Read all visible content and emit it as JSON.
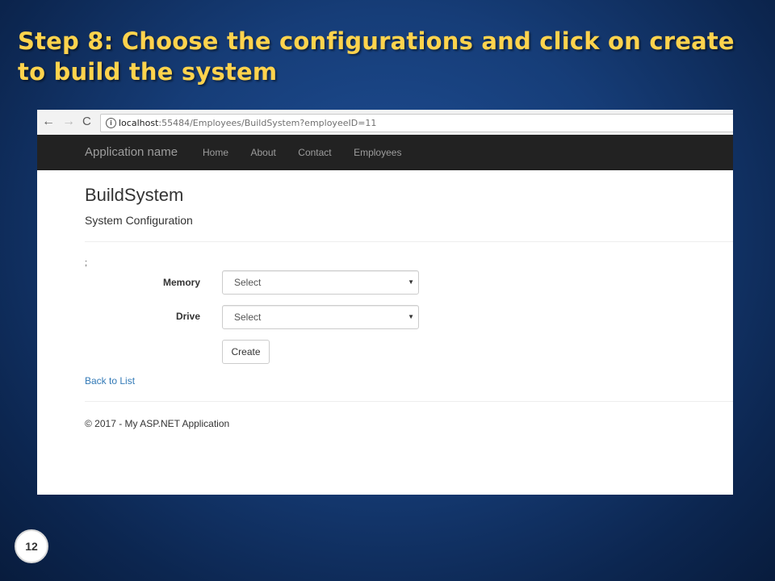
{
  "slide": {
    "title": "Step 8:  Choose the configurations and click on create to build the system",
    "number": "12"
  },
  "browser": {
    "back_icon": "←",
    "forward_icon": "→",
    "reload_icon": "C",
    "info_icon": "i",
    "url_host": "localhost",
    "url_rest": ":55484/Employees/BuildSystem?employeeID=11"
  },
  "navbar": {
    "brand": "Application name",
    "links": [
      "Home",
      "About",
      "Contact",
      "Employees"
    ]
  },
  "page": {
    "heading": "BuildSystem",
    "subheading": "System Configuration",
    "stray_text": ";"
  },
  "form": {
    "memory_label": "Memory",
    "memory_value": "Select",
    "drive_label": "Drive",
    "drive_value": "Select",
    "caret": "▼",
    "create_label": "Create"
  },
  "back_link": "Back to List",
  "footer": "© 2017 - My ASP.NET Application",
  "colors": {
    "title": "#ffd34d",
    "navbar": "#222222",
    "link": "#337ab7"
  }
}
